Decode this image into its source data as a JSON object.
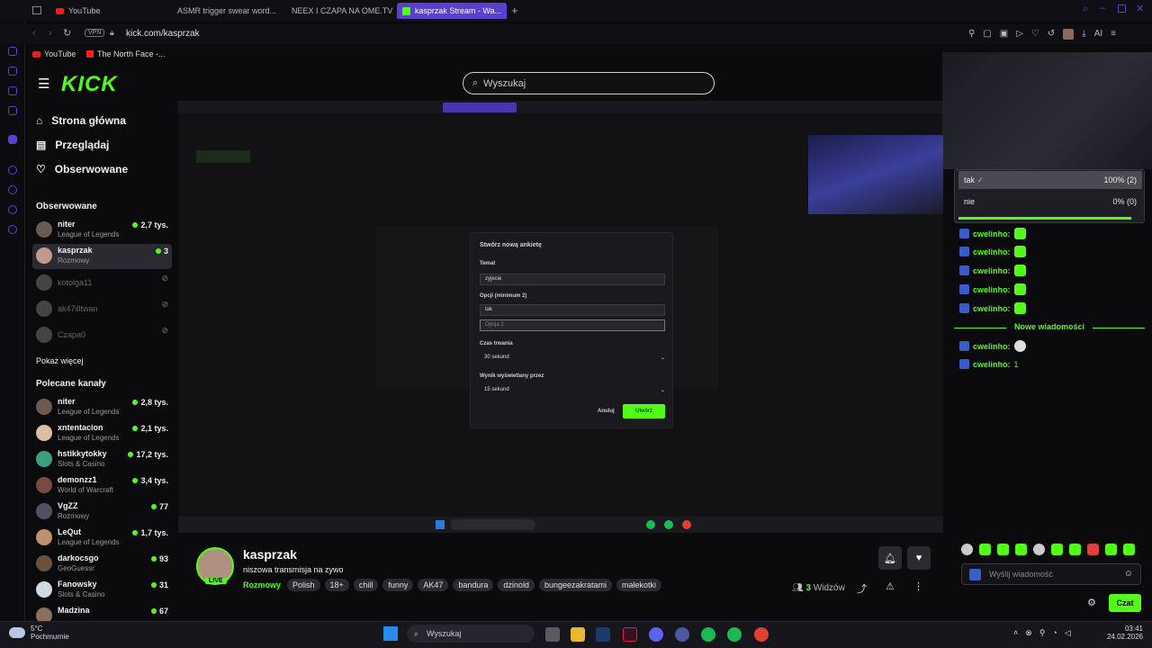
{
  "browser": {
    "tabs": [
      {
        "label": "YouTube"
      },
      {
        "label": "ASMR trigger swear word..."
      },
      {
        "label": "NEEX I CZAPA NA OME.TV"
      },
      {
        "label": "kasprzak Stream - Wa..."
      }
    ],
    "vpn_label": "VPN",
    "url": "kick.com/kasprzak",
    "ai_label": "AI",
    "bookmarks": [
      {
        "label": "YouTube"
      },
      {
        "label": "The North Face -..."
      }
    ]
  },
  "kick": {
    "logo": "KICK",
    "search_placeholder": "Wyszukaj",
    "nav": [
      {
        "label": "Strona główna"
      },
      {
        "label": "Przeglądaj"
      },
      {
        "label": "Obserwowane"
      }
    ],
    "followed_title": "Obserwowane",
    "followed": [
      {
        "name": "niter",
        "category": "League of Legends",
        "viewers": "2,7 tys."
      },
      {
        "name": "kasprzak",
        "category": "Rozmowy",
        "viewers": "3"
      },
      {
        "name": "kotolga11",
        "category": "",
        "viewers": ""
      },
      {
        "name": "ak47illtwan",
        "category": "",
        "viewers": ""
      },
      {
        "name": "Czapa0",
        "category": "",
        "viewers": ""
      }
    ],
    "show_more": "Pokaż więcej",
    "recommended_title": "Polecane kanały",
    "recommended": [
      {
        "name": "niter",
        "category": "League of Legends",
        "viewers": "2,8 tys."
      },
      {
        "name": "xntentacion",
        "category": "League of Legends",
        "viewers": "2,1 tys."
      },
      {
        "name": "hstikkytokky",
        "category": "Slots & Casino",
        "viewers": "17,2 tys."
      },
      {
        "name": "demonzz1",
        "category": "World of Warcraft",
        "viewers": "3,4 tys."
      },
      {
        "name": "VgZZ",
        "category": "Rozmowy",
        "viewers": "77"
      },
      {
        "name": "LeQut",
        "category": "League of Legends",
        "viewers": "1,7 tys."
      },
      {
        "name": "darkocsgo",
        "category": "GeoGuessr",
        "viewers": "93"
      },
      {
        "name": "Fanowsky",
        "category": "Slots & Casino",
        "viewers": "31"
      },
      {
        "name": "Madzina",
        "category": "",
        "viewers": "67"
      }
    ]
  },
  "poll_modal": {
    "title": "Stwórz nową ankietę",
    "topic_label": "Temat",
    "topic_value": "zyjecie",
    "options_label": "Opcji (minimum 2)",
    "option1": "tak",
    "option2_placeholder": "Opcja 2",
    "duration_label": "Czas trwania",
    "duration_value": "30 sekund",
    "result_label": "Wynik wyświetlany przez",
    "result_value": "15 sekund",
    "cancel": "Anuluj",
    "create": "Utwórz"
  },
  "stream_info": {
    "streamer": "kasprzak",
    "live": "LIVE",
    "title": "niszowa transmisja na zywo",
    "category": "Rozmowy",
    "tags": [
      "Polish",
      "18+",
      "chill",
      "funny",
      "AK47",
      "bandura",
      "dzinold",
      "bungeezakratami",
      "małekotki"
    ],
    "viewers_count": "3",
    "viewers_label": "Widzów"
  },
  "poll": {
    "options": [
      {
        "label": "tak",
        "result": "100% (2)",
        "fraction": 1.0
      },
      {
        "label": "nie",
        "result": "0% (0)",
        "fraction": 0.0
      }
    ]
  },
  "chat": {
    "messages": [
      {
        "user": "cwelinho:",
        "text": ""
      },
      {
        "user": "cwelinho:",
        "text": ""
      },
      {
        "user": "cwelinho:",
        "text": ""
      },
      {
        "user": "cwelinho:",
        "text": ""
      },
      {
        "user": "cwelinho:",
        "text": ""
      }
    ],
    "new_messages_label": "Nowe wiadomości",
    "new_messages": [
      {
        "user": "cwelinho:",
        "text": ""
      },
      {
        "user": "cwelinho:",
        "text": "1"
      }
    ],
    "input_placeholder": "Wyślij wiadomość",
    "send_label": "Czat"
  },
  "taskbar": {
    "weather_temp": "5°C",
    "weather_desc": "Pochmurnie",
    "search_placeholder": "Wyszukaj",
    "time": "03:41",
    "date": "24.02.2026"
  },
  "colors": {
    "accent": "#53fc18",
    "tab_active": "#5a3fd0",
    "background": "#0b0b0e"
  }
}
